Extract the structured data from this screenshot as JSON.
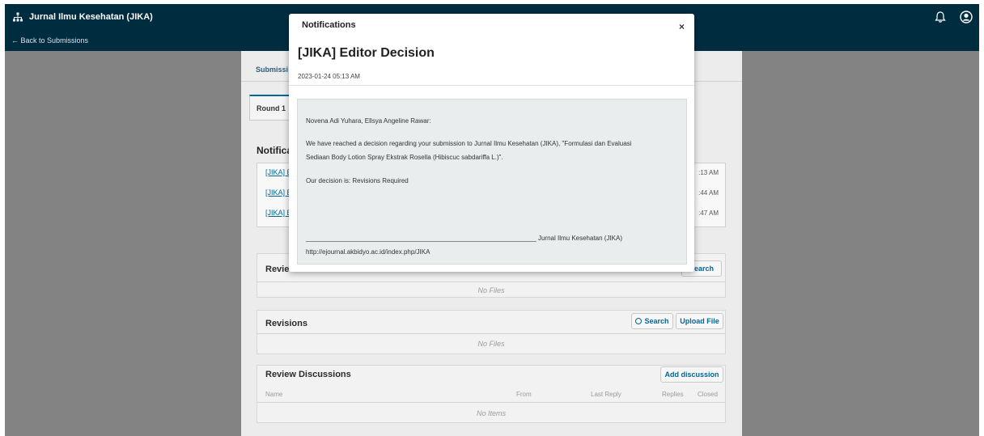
{
  "header": {
    "site_title": "Jurnal Ilmu Kesehatan (JIKA)",
    "back_link": "← Back to Submissions",
    "icons": {
      "site": "sitemap-icon",
      "notifications": "bell-icon",
      "user": "user-circle-icon"
    }
  },
  "background": {
    "tab_label": "Submissi",
    "round_tab": "Round 1",
    "notifications_heading": "Notifica",
    "notification_links": [
      "[JIKA] E",
      "[JIKA] E",
      "[JIKA] E"
    ],
    "notification_times": [
      ":13 AM",
      ":44 AM",
      ":47 AM"
    ],
    "review_files": {
      "title": "Revie",
      "search_label": "Search",
      "empty": "No Files"
    },
    "revisions": {
      "title": "Revisions",
      "search_label": "Search",
      "upload_label": "Upload File",
      "empty": "No Files"
    },
    "review_discussions": {
      "title": "Review Discussions",
      "add_label": "Add discussion",
      "columns": [
        "Name",
        "From",
        "Last Reply",
        "Replies",
        "Closed"
      ],
      "empty": "No Items"
    }
  },
  "modal": {
    "title": "Notifications",
    "close_label": "×",
    "subject": "[JIKA] Editor Decision",
    "date": "2023-01-24 05:13 AM",
    "greeting": "Novena Adi Yuhara, Ellsya Angeline Rawar:",
    "body_line1": "We have reached a decision regarding your submission to Jurnal Ilmu Kesehatan (JIKA), \"Formulasi dan Evaluasi",
    "body_line2": "Sediaan Body Lotion Spray Ekstrak Rosella (Hibiscuc sabdariffa L.)\".",
    "decision": "Our decision is: Revisions Required",
    "signature": "________________________________________________________________ Jurnal Ilmu Kesehatan (JIKA)",
    "url": "http://ejournal.akbidyo.ac.id/index.php/JIKA"
  },
  "colors": {
    "header_bg": "#002c40",
    "backdrop": "#838383",
    "link": "#006798",
    "message_bg": "#eaeded"
  }
}
